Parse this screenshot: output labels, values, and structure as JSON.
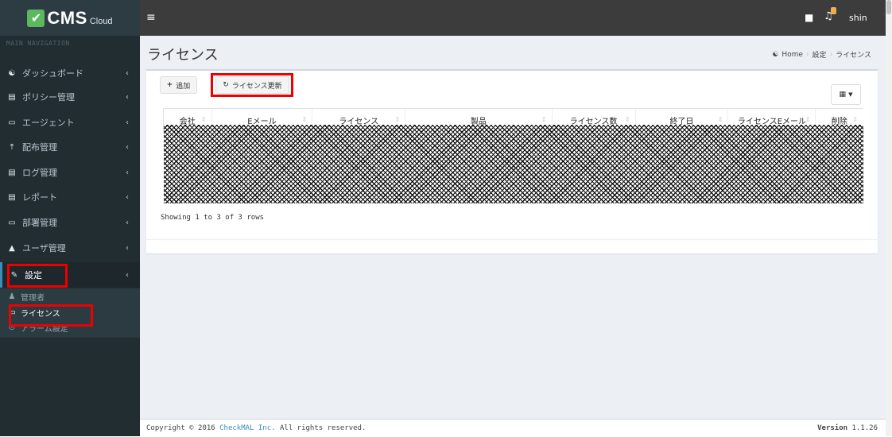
{
  "app": {
    "brand": "CMS",
    "brand_suffix": "Cloud",
    "check_glyph": "✔"
  },
  "topbar": {
    "menu_icon": "hamburger-icon",
    "username": "shin",
    "notification_color": "#f0ad4e"
  },
  "sidebar": {
    "header": "MAIN NAVIGATION",
    "items": [
      {
        "label": "ダッシュボード",
        "icon": "tachometer-icon",
        "glyph": "☯"
      },
      {
        "label": "ポリシー管理",
        "icon": "list-icon",
        "glyph": "▤"
      },
      {
        "label": "エージェント",
        "icon": "monitor-icon",
        "glyph": "▭"
      },
      {
        "label": "配布管理",
        "icon": "upload-icon",
        "glyph": "⤒"
      },
      {
        "label": "ログ管理",
        "icon": "log-icon",
        "glyph": "▤"
      },
      {
        "label": "レポート",
        "icon": "report-icon",
        "glyph": "▤"
      },
      {
        "label": "部署管理",
        "icon": "folder-icon",
        "glyph": "▭"
      },
      {
        "label": "ユーザ管理",
        "icon": "user-icon",
        "glyph": "▲"
      },
      {
        "label": "設定",
        "icon": "wrench-icon",
        "glyph": "✎"
      }
    ],
    "submenu": [
      {
        "label": "管理者",
        "icon": "admin-icon",
        "glyph": "♟"
      },
      {
        "label": "ライセンス",
        "icon": "card-icon",
        "glyph": "▭"
      },
      {
        "label": "アラーム設定",
        "icon": "clock-icon",
        "glyph": "⊙"
      }
    ]
  },
  "page": {
    "title": "ライセンス",
    "breadcrumb": [
      "Home",
      "設定",
      "ライセンス"
    ]
  },
  "toolbar": {
    "add_label": "追加",
    "renew_label": "ライセンス更新"
  },
  "table": {
    "columns": [
      "会社",
      "Eメール",
      "ライセンス",
      "製品",
      "ライセンス数",
      "終了日",
      "ライセンスEメール",
      "削除"
    ],
    "rows_info": "Showing 1 to 3 of 3 rows"
  },
  "footer": {
    "copyright_prefix": "Copyright © 2016",
    "company": "CheckMAL Inc.",
    "copyright_suffix": "All rights reserved.",
    "version_label": "Version",
    "version": "1.1.26"
  },
  "highlight_color": "#e00000"
}
